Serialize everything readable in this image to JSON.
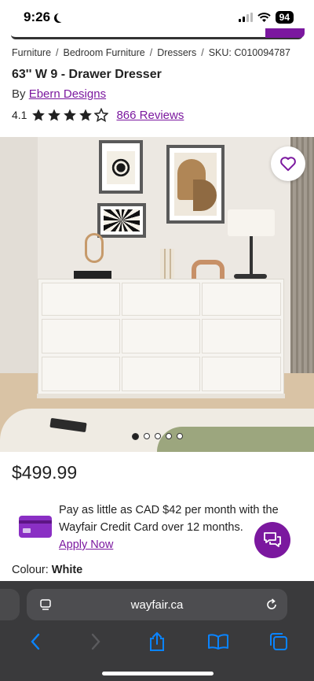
{
  "status_bar": {
    "time": "9:26",
    "battery": "94"
  },
  "breadcrumb": {
    "items": [
      "Furniture",
      "Bedroom Furniture",
      "Dressers"
    ],
    "separator": "/",
    "sku": "SKU: C010094787"
  },
  "product": {
    "title": "63'' W 9 - Drawer Dresser",
    "by_prefix": "By",
    "brand": "Ebern Designs",
    "rating_value": "4.1",
    "rating_fraction": 0.82,
    "reviews_link": "866 Reviews",
    "price": "$499.99",
    "image_count": 5,
    "image_active_index": 0,
    "colour_label": "Colour:",
    "colour_value": "White"
  },
  "credit": {
    "text": "Pay as little as CAD $42 per month with the Wayfair Credit Card over 12 months.",
    "link": "Apply Now"
  },
  "browser": {
    "url": "wayfair.ca"
  },
  "colors": {
    "brand_purple": "#7b189f",
    "browser_bg": "#3a3a3c",
    "toolbar_icon": "#0a84ff"
  },
  "icons": {
    "favorite": "heart-outline-icon",
    "chat": "chat-bubbles-icon",
    "share": "share-icon",
    "bookmarks": "book-icon",
    "tabs": "tabs-icon",
    "back": "chevron-left-icon",
    "forward": "chevron-right-icon",
    "reload": "reload-icon",
    "reader": "reader-menu-icon"
  }
}
